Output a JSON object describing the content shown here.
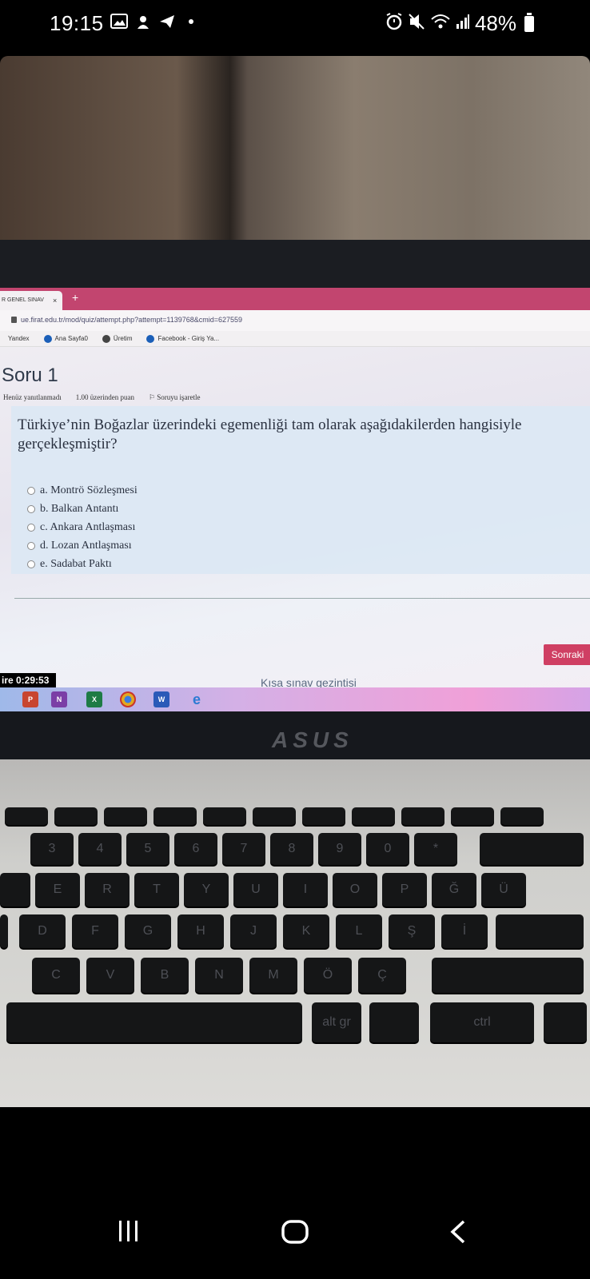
{
  "status_bar": {
    "time": "19:15",
    "battery": "48%"
  },
  "browser": {
    "tab_title": "R GENEL SINAV",
    "tab_close": "×",
    "tab_new": "+",
    "url": "ue.firat.edu.tr/mod/quiz/attempt.php?attempt=1139768&cmid=627559",
    "bookmarks": [
      "Yandex",
      "Ana Sayfa0",
      "Üretim",
      "Facebook - Giriş Ya..."
    ]
  },
  "quiz": {
    "title": "Soru 1",
    "meta": [
      "Henüz yanıtlanmadı",
      "1.00 üzerinden puan",
      "Soruyu işaretle"
    ],
    "question": "Türkiye’nin Boğazlar üzerindeki egemenliği tam olarak aşağıdakilerden hangisiyle gerçekleşmiştir?",
    "options": [
      "a. Montrö Sözleşmesi",
      "b. Balkan Antantı",
      "c. Ankara Antlaşması",
      "d. Lozan Antlaşması",
      "e. Sadabat Paktı"
    ],
    "next_label": "Sonraki",
    "timer": "ire 0:29:53",
    "nav_label": "Kısa sınav gezintisi"
  },
  "laptop": {
    "brand": "ASUS",
    "taskbar_apps": [
      "P",
      "N",
      "X",
      "",
      "W",
      "e"
    ],
    "taskbar_colors": [
      "#c8452f",
      "#7b3fa6",
      "#1e7b45",
      "#e1a821",
      "#2a5ab8",
      "#2b7bd3"
    ]
  },
  "keyboard_labels": {
    "row_nums": [
      "3",
      "4",
      "5",
      "6",
      "7",
      "8",
      "9",
      "0",
      "*"
    ],
    "row_q": [
      "E",
      "R",
      "T",
      "Y",
      "U",
      "I",
      "O",
      "P",
      "Ğ",
      "Ü"
    ],
    "row_a": [
      "D",
      "F",
      "G",
      "H",
      "J",
      "K",
      "L",
      "Ş",
      "İ"
    ],
    "row_z": [
      "C",
      "V",
      "B",
      "N",
      "M",
      "Ö",
      "Ç"
    ],
    "alt_gr": "alt gr",
    "ctrl": "ctrl"
  }
}
